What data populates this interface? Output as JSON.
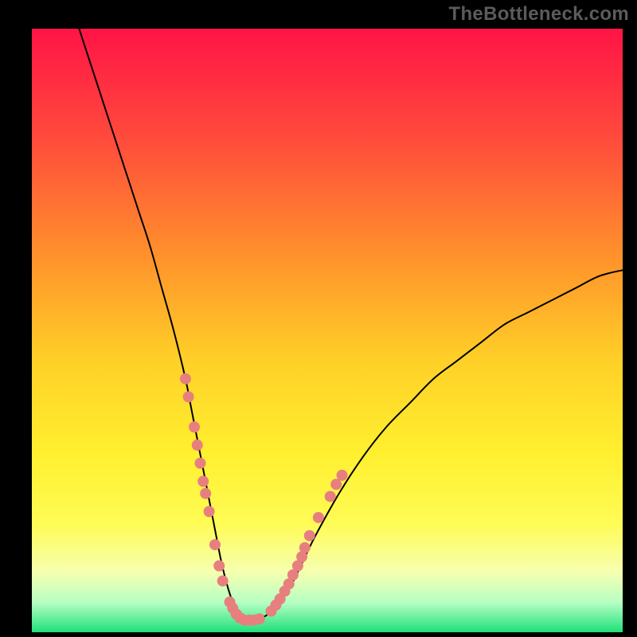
{
  "watermark": "TheBottleneck.com",
  "chart_data": {
    "type": "line",
    "title": "",
    "xlabel": "",
    "ylabel": "",
    "xlim": [
      0,
      100
    ],
    "ylim": [
      0,
      100
    ],
    "grid": false,
    "legend": false,
    "background_gradient": {
      "top_color": "#ff1446",
      "mid_color": "#ffdd20",
      "bottom_color": "#1fe07a",
      "stops": [
        {
          "offset": 0.0,
          "color": "#ff1446"
        },
        {
          "offset": 0.18,
          "color": "#ff4a3c"
        },
        {
          "offset": 0.4,
          "color": "#ff9a2a"
        },
        {
          "offset": 0.55,
          "color": "#ffd028"
        },
        {
          "offset": 0.7,
          "color": "#ffef2e"
        },
        {
          "offset": 0.82,
          "color": "#fffc55"
        },
        {
          "offset": 0.9,
          "color": "#f6ffb0"
        },
        {
          "offset": 0.95,
          "color": "#b8ffc4"
        },
        {
          "offset": 1.0,
          "color": "#1fe07a"
        }
      ]
    },
    "series": [
      {
        "name": "bottleneck-curve",
        "stroke": "#000000",
        "stroke_width": 2,
        "x": [
          8,
          10,
          12,
          14,
          16,
          18,
          20,
          22,
          24,
          26,
          27,
          28,
          29,
          30,
          31,
          32,
          33,
          34,
          35,
          36,
          37,
          38,
          40,
          42,
          44,
          46,
          48,
          52,
          56,
          60,
          64,
          68,
          72,
          76,
          80,
          84,
          88,
          92,
          96,
          100
        ],
        "y": [
          100,
          94,
          88,
          82,
          76,
          70,
          64,
          57,
          50,
          42,
          37,
          32,
          27,
          22,
          17,
          12,
          8,
          5,
          3,
          2,
          2,
          2,
          3,
          5,
          8,
          12,
          16,
          23,
          29,
          34,
          38,
          42,
          45,
          48,
          51,
          53,
          55,
          57,
          59,
          60
        ]
      }
    ],
    "markers": [
      {
        "name": "bottleneck-markers",
        "fill": "#e77f7f",
        "color": "#e77f7f",
        "radius": 7,
        "x": [
          26.0,
          26.5,
          27.5,
          28.0,
          28.5,
          29.0,
          29.4,
          30.0,
          31.0,
          31.7,
          32.3,
          33.5,
          34.0,
          34.6,
          35.2,
          36.0,
          36.8,
          37.6,
          38.5,
          40.5,
          41.3,
          42.0,
          42.8,
          43.5,
          44.2,
          45.0,
          45.7,
          46.2,
          47.0,
          48.5
        ],
        "y": [
          42.0,
          39.0,
          34.0,
          31.0,
          28.0,
          25.0,
          23.0,
          20.0,
          14.5,
          11.0,
          8.5,
          5.0,
          4.0,
          3.0,
          2.4,
          2.0,
          2.0,
          2.0,
          2.2,
          3.5,
          4.5,
          5.5,
          6.8,
          8.0,
          9.5,
          11.0,
          12.5,
          14.0,
          16.0,
          19.0
        ]
      },
      {
        "name": "right-cluster",
        "fill": "#e77f7f",
        "color": "#e77f7f",
        "radius": 7,
        "x": [
          50.5,
          51.5,
          52.5
        ],
        "y": [
          22.5,
          24.5,
          26.0
        ]
      }
    ]
  }
}
